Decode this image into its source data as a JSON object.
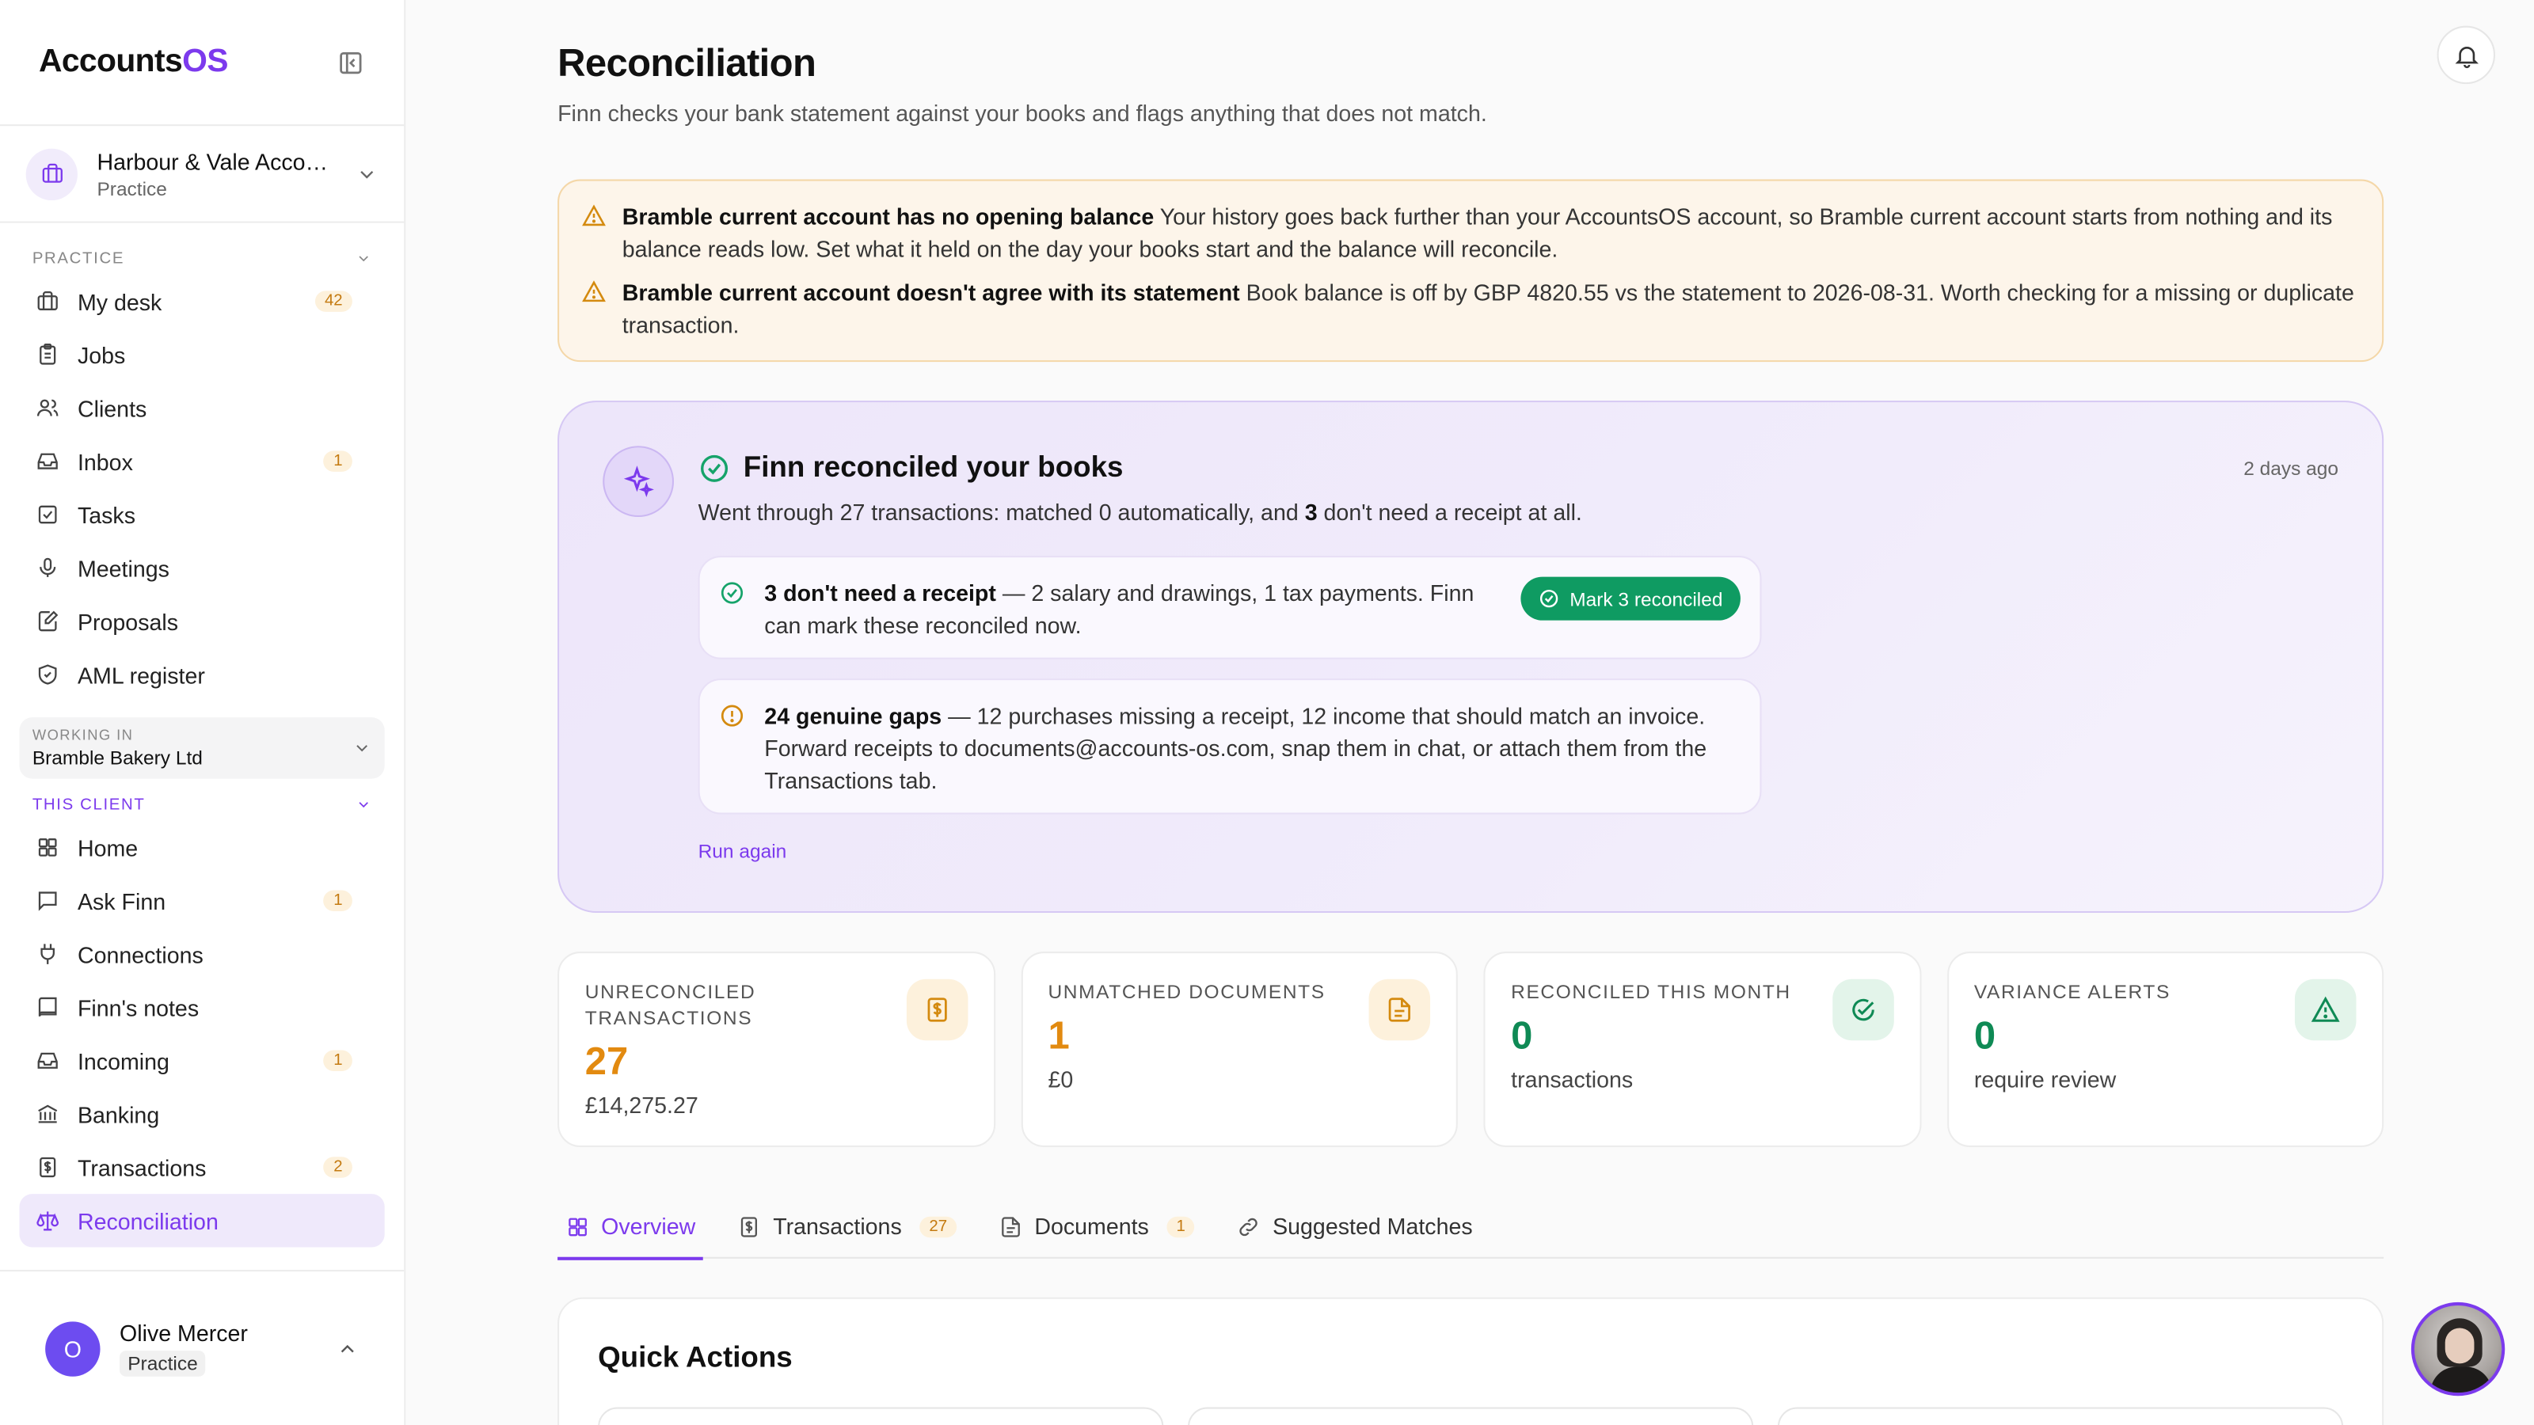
{
  "brand": {
    "name_main": "Accounts",
    "name_accent": "OS"
  },
  "org": {
    "name": "Harbour & Vale Accou...",
    "sub": "Practice"
  },
  "practice": {
    "label": "PRACTICE",
    "items": [
      {
        "label": "My desk",
        "badge": "42",
        "icon": "briefcase-icon"
      },
      {
        "label": "Jobs",
        "badge": "",
        "icon": "clipboard-icon"
      },
      {
        "label": "Clients",
        "badge": "",
        "icon": "users-icon"
      },
      {
        "label": "Inbox",
        "badge": "1",
        "icon": "inbox-icon"
      },
      {
        "label": "Tasks",
        "badge": "",
        "icon": "checkbox-icon"
      },
      {
        "label": "Meetings",
        "badge": "",
        "icon": "mic-icon"
      },
      {
        "label": "Proposals",
        "badge": "",
        "icon": "edit-doc-icon"
      },
      {
        "label": "AML register",
        "badge": "",
        "icon": "shield-icon"
      }
    ]
  },
  "working_in": {
    "label": "WORKING IN",
    "value": "Bramble Bakery Ltd"
  },
  "client": {
    "label": "THIS CLIENT",
    "items": [
      {
        "label": "Home",
        "badge": "",
        "icon": "grid-icon"
      },
      {
        "label": "Ask Finn",
        "badge": "1",
        "icon": "chat-icon"
      },
      {
        "label": "Connections",
        "badge": "",
        "icon": "plug-icon"
      },
      {
        "label": "Finn's notes",
        "badge": "",
        "icon": "book-icon"
      },
      {
        "label": "Incoming",
        "badge": "1",
        "icon": "inbox-icon"
      },
      {
        "label": "Banking",
        "badge": "",
        "icon": "bank-icon"
      },
      {
        "label": "Transactions",
        "badge": "2",
        "icon": "dollar-doc-icon"
      },
      {
        "label": "Reconciliation",
        "badge": "",
        "icon": "scale-icon"
      }
    ]
  },
  "user": {
    "initial": "O",
    "name": "Olive Mercer",
    "role": "Practice"
  },
  "page": {
    "title": "Reconciliation",
    "subtitle": "Finn checks your bank statement against your books and flags anything that does not match."
  },
  "warnings": [
    {
      "title": "Bramble current account has no opening balance",
      "text": " Your history goes back further than your AccountsOS account, so Bramble current account starts from nothing and its balance reads low. Set what it held on the day your books start and the balance will reconcile."
    },
    {
      "title": "Bramble current account doesn't agree with its statement",
      "text": " Book balance is off by GBP 4820.55 vs the statement to 2026-08-31. Worth checking for a missing or duplicate transaction."
    }
  ],
  "finn": {
    "title": "Finn reconciled your books",
    "time": "2 days ago",
    "desc_pre": "Went through 27 transactions: matched 0 automatically, and ",
    "desc_bold": "3",
    "desc_post": " don't need a receipt at all.",
    "ok_bold": "3 don't need a receipt",
    "ok_text": " — 2 salary and drawings, 1 tax payments. Finn can mark these reconciled now.",
    "mark_label": "Mark 3 reconciled",
    "gap_bold": "24 genuine gaps",
    "gap_text": " — 12 purchases missing a receipt, 12 income that should match an invoice. Forward receipts to documents@accounts-os.com, snap them in chat, or attach them from the Transactions tab.",
    "run_again": "Run again"
  },
  "stats": [
    {
      "label": "UNRECONCILED TRANSACTIONS",
      "value": "27",
      "sub": "£14,275.27",
      "tone": "amber",
      "icon": "dollar-doc-icon"
    },
    {
      "label": "UNMATCHED DOCUMENTS",
      "value": "1",
      "sub": "£0",
      "tone": "amber",
      "icon": "document-icon"
    },
    {
      "label": "RECONCILED THIS MONTH",
      "value": "0",
      "sub": "transactions",
      "tone": "green",
      "icon": "check-circle-icon"
    },
    {
      "label": "VARIANCE ALERTS",
      "value": "0",
      "sub": "require review",
      "tone": "green",
      "icon": "alert-triangle-icon"
    }
  ],
  "tabs": [
    {
      "label": "Overview",
      "badge": ""
    },
    {
      "label": "Transactions",
      "badge": "27"
    },
    {
      "label": "Documents",
      "badge": "1"
    },
    {
      "label": "Suggested Matches",
      "badge": ""
    }
  ],
  "quick_actions": {
    "title": "Quick Actions"
  },
  "colors": {
    "accent": "#7c3aed",
    "amber": "#e28a10",
    "green": "#0f8a55"
  }
}
